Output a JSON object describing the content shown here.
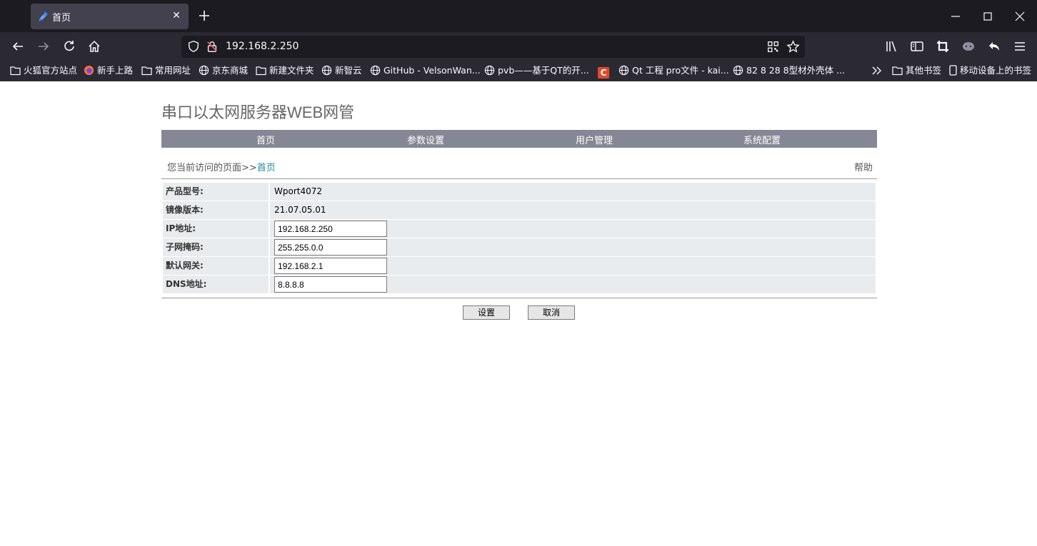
{
  "browser": {
    "tab_title": "首页",
    "tab_close": "✕",
    "url": "192.168.2.250",
    "bookmarks": [
      {
        "label": "火狐官方站点",
        "icon": "folder-icon"
      },
      {
        "label": "新手上路",
        "icon": "firefox-icon"
      },
      {
        "label": "常用网址",
        "icon": "folder-icon"
      },
      {
        "label": "京东商城",
        "icon": "globe-icon"
      },
      {
        "label": "新建文件夹",
        "icon": "folder-icon"
      },
      {
        "label": "新智云",
        "icon": "globe-icon"
      },
      {
        "label": "GitHub - VelsonWan...",
        "icon": "globe-icon"
      },
      {
        "label": "pvb——基于QT的开...",
        "icon": "globe-icon"
      },
      {
        "label": "C",
        "icon": "csdn-icon"
      },
      {
        "label": "Qt 工程 pro文件 - kai...",
        "icon": "globe-icon"
      },
      {
        "label": "82 8 28 8型材外壳体 ...",
        "icon": "globe-icon"
      },
      {
        "label": "其他书签",
        "icon": "folder-icon"
      },
      {
        "label": "移动设备上的书签",
        "icon": "mobile-icon"
      }
    ]
  },
  "page": {
    "title": "串口以太网服务器WEB网管",
    "menu": [
      "首页",
      "参数设置",
      "用户管理",
      "系统配置"
    ],
    "breadcrumb_prefix": "您当前访问的页面>>",
    "breadcrumb_current": "首页",
    "help": "帮助",
    "fields": {
      "model_label": "产品型号:",
      "model_value": "Wport4072",
      "image_label": "镜像版本:",
      "image_value": "21.07.05.01",
      "ip_label": "IP地址:",
      "ip_value": "192.168.2.250",
      "mask_label": "子网掩码:",
      "mask_value": "255.255.0.0",
      "gateway_label": "默认网关:",
      "gateway_value": "192.168.2.1",
      "dns_label": "DNS地址:",
      "dns_value": "8.8.8.8"
    },
    "set_button": "设置",
    "cancel_button": "取消"
  }
}
